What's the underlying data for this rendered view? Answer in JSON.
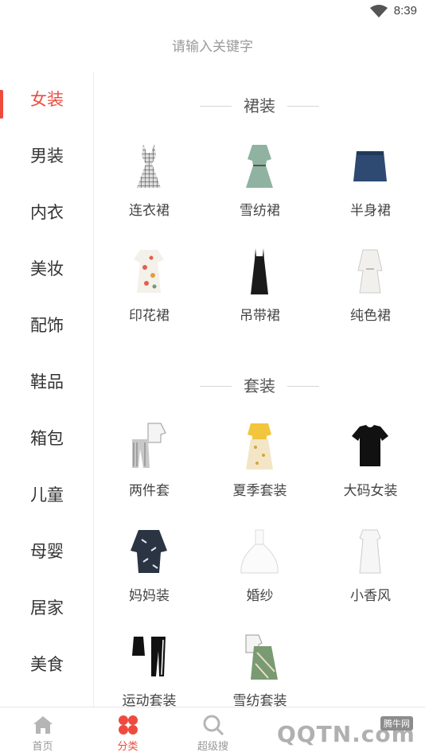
{
  "status_bar": {
    "time": "8:39"
  },
  "search": {
    "placeholder": "请输入关键字"
  },
  "sidebar": {
    "items": [
      {
        "label": "女装"
      },
      {
        "label": "男装"
      },
      {
        "label": "内衣"
      },
      {
        "label": "美妆"
      },
      {
        "label": "配饰"
      },
      {
        "label": "鞋品"
      },
      {
        "label": "箱包"
      },
      {
        "label": "儿童"
      },
      {
        "label": "母婴"
      },
      {
        "label": "居家"
      },
      {
        "label": "美食"
      }
    ],
    "active_index": 0
  },
  "sections": [
    {
      "title": "裙装",
      "items": [
        {
          "label": "连衣裙"
        },
        {
          "label": "雪纺裙"
        },
        {
          "label": "半身裙"
        },
        {
          "label": "印花裙"
        },
        {
          "label": "吊带裙"
        },
        {
          "label": "纯色裙"
        }
      ]
    },
    {
      "title": "套装",
      "items": [
        {
          "label": "两件套"
        },
        {
          "label": "夏季套装"
        },
        {
          "label": "大码女装"
        },
        {
          "label": "妈妈装"
        },
        {
          "label": "婚纱"
        },
        {
          "label": "小香风"
        },
        {
          "label": "运动套装"
        },
        {
          "label": "雪纺套装"
        }
      ]
    }
  ],
  "tabbar": {
    "tabs": [
      {
        "label": "首页",
        "icon": "home-icon"
      },
      {
        "label": "分类",
        "icon": "category-icon"
      },
      {
        "label": "超级搜",
        "icon": "search-icon"
      }
    ]
  },
  "watermark": {
    "text": "QQTN.com",
    "badge": "腾牛网"
  },
  "colors": {
    "accent": "#ee4b3e",
    "text": "#333333",
    "muted": "#999999"
  }
}
